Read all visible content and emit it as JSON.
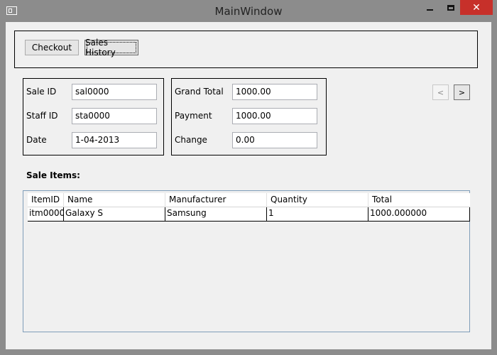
{
  "window": {
    "title": "MainWindow",
    "close_glyph": "✕",
    "icons": {
      "app": "window-app-icon",
      "minimize": "minimize-icon",
      "maximize": "maximize-icon",
      "close": "close-icon"
    },
    "close_color": "#c7302a"
  },
  "toolbar": {
    "checkout_label": "Checkout",
    "history_label": "Sales History"
  },
  "sale": {
    "sale_id_label": "Sale ID",
    "sale_id_value": "sal0000",
    "staff_id_label": "Staff ID",
    "staff_id_value": "sta0000",
    "date_label": "Date",
    "date_value": "1-04-2013"
  },
  "totals": {
    "grand_total_label": "Grand Total",
    "grand_total_value": "1000.00",
    "payment_label": "Payment",
    "payment_value": "1000.00",
    "change_label": "Change",
    "change_value": "0.00"
  },
  "nav": {
    "prev_label": "<",
    "next_label": ">"
  },
  "items": {
    "section_label": "Sale Items:",
    "columns": [
      "ItemID",
      "Name",
      "Manufacturer",
      "Quantity",
      "Total"
    ],
    "rows": [
      [
        "itm0000",
        "Galaxy S",
        "Samsung",
        "1",
        "1000.000000"
      ]
    ]
  }
}
